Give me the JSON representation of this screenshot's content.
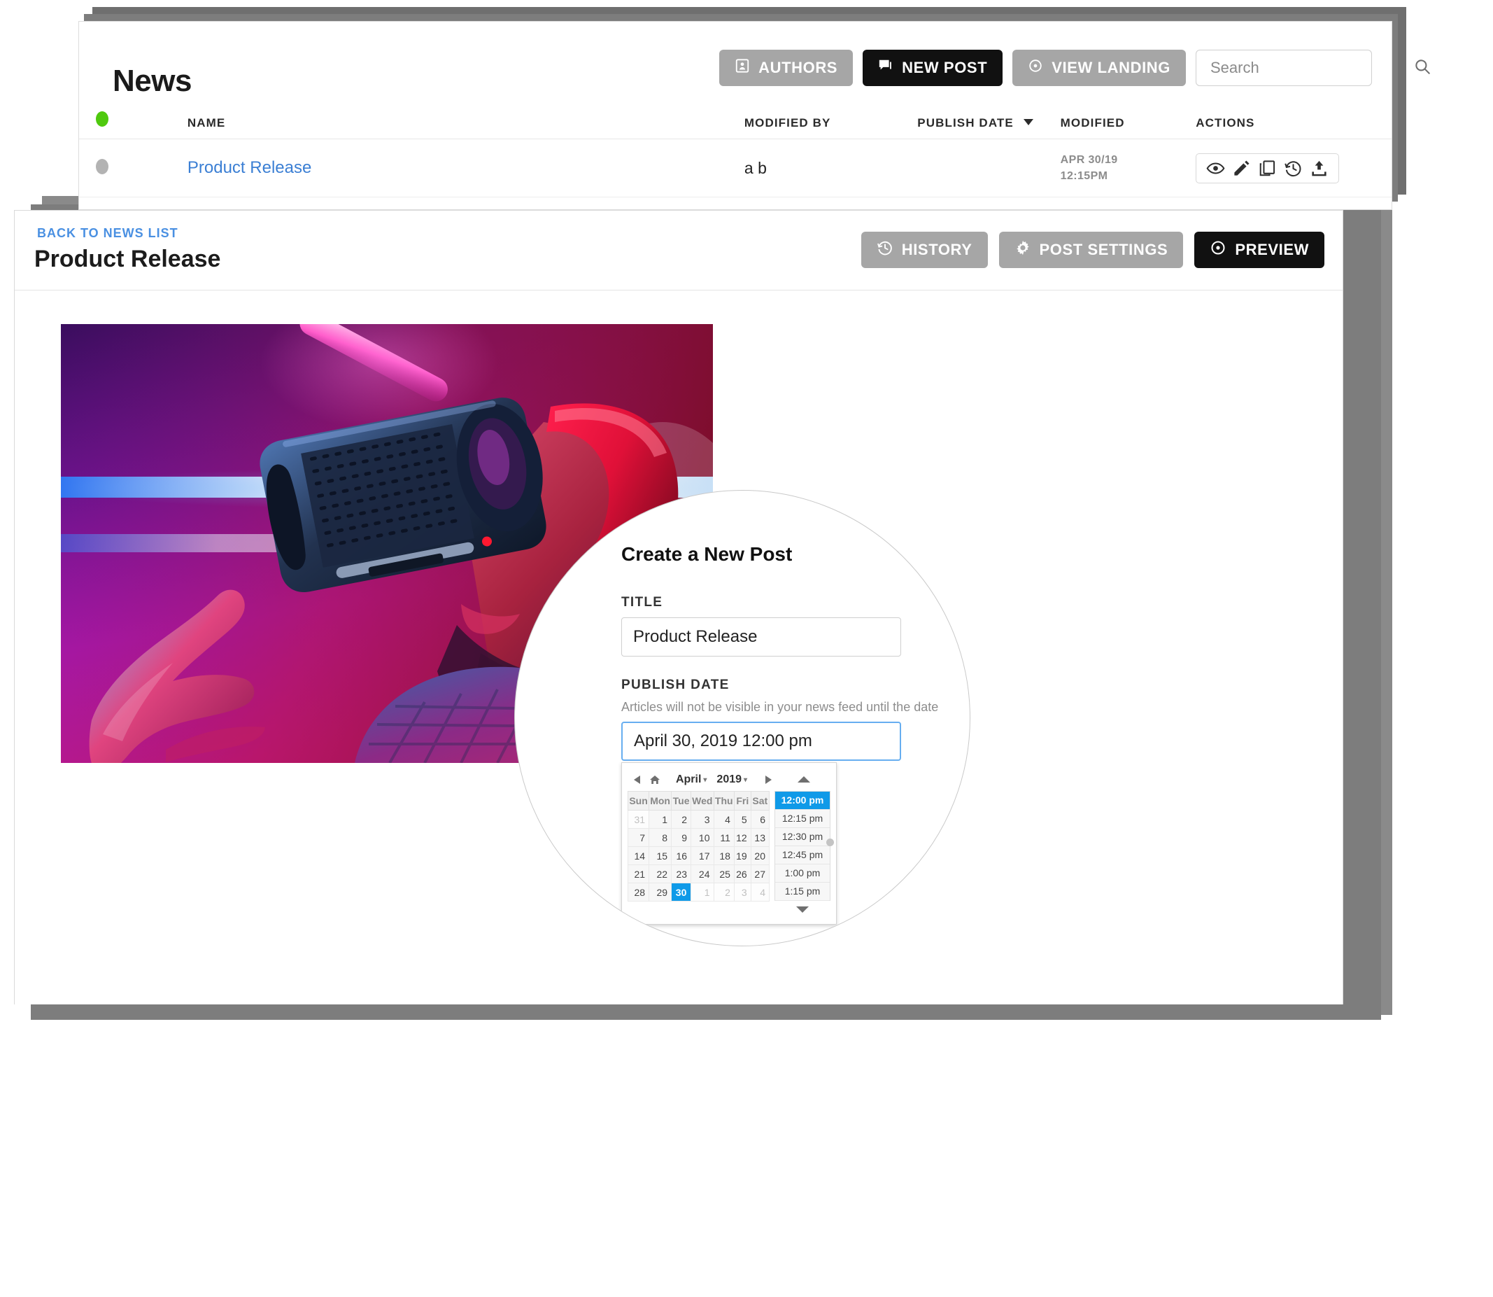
{
  "news_window": {
    "page_title": "News",
    "toolbar": {
      "authors_label": "AUTHORS",
      "new_post_label": "NEW POST",
      "view_landing_label": "VIEW LANDING",
      "search_placeholder": "Search",
      "search_value": ""
    },
    "table": {
      "columns": [
        "",
        "NAME",
        "MODIFIED BY",
        "PUBLISH DATE",
        "MODIFIED",
        "ACTIONS"
      ],
      "sort_column": "PUBLISH DATE",
      "sort_direction": "desc",
      "rows": [
        {
          "status": "draft",
          "name": "Product Release",
          "modified_by": "a b",
          "publish_date": "",
          "modified_date": "APR 30/19",
          "modified_time": "12:15PM",
          "actions": [
            "preview-icon",
            "edit-icon",
            "duplicate-icon",
            "history-icon",
            "publish-icon"
          ]
        }
      ]
    }
  },
  "post_window": {
    "back_link": "BACK TO NEWS LIST",
    "title": "Product Release",
    "actions": {
      "history_label": "HISTORY",
      "post_settings_label": "POST SETTINGS",
      "preview_label": "PREVIEW"
    },
    "hero_image_alt": "man wearing vr headset in neon lighting"
  },
  "magnifier": {
    "heading": "Create a New Post",
    "title_label": "TITLE",
    "title_value": "Product Release",
    "publish_date_label": "PUBLISH DATE",
    "publish_date_help": "Articles will not be visible in your news feed until the date",
    "publish_date_value": "April 30, 2019 12:00 pm",
    "datepicker": {
      "month": "April",
      "year": "2019",
      "weekdays": [
        "Sun",
        "Mon",
        "Tue",
        "Wed",
        "Thu",
        "Fri",
        "Sat"
      ],
      "weeks": [
        [
          {
            "d": "31",
            "o": true
          },
          {
            "d": "1"
          },
          {
            "d": "2"
          },
          {
            "d": "3"
          },
          {
            "d": "4"
          },
          {
            "d": "5"
          },
          {
            "d": "6"
          }
        ],
        [
          {
            "d": "7"
          },
          {
            "d": "8"
          },
          {
            "d": "9"
          },
          {
            "d": "10"
          },
          {
            "d": "11"
          },
          {
            "d": "12"
          },
          {
            "d": "13"
          }
        ],
        [
          {
            "d": "14"
          },
          {
            "d": "15"
          },
          {
            "d": "16"
          },
          {
            "d": "17"
          },
          {
            "d": "18"
          },
          {
            "d": "19"
          },
          {
            "d": "20"
          }
        ],
        [
          {
            "d": "21"
          },
          {
            "d": "22"
          },
          {
            "d": "23"
          },
          {
            "d": "24"
          },
          {
            "d": "25"
          },
          {
            "d": "26"
          },
          {
            "d": "27"
          }
        ],
        [
          {
            "d": "28"
          },
          {
            "d": "29"
          },
          {
            "d": "30",
            "sel": true
          },
          {
            "d": "1",
            "o": true
          },
          {
            "d": "2",
            "o": true
          },
          {
            "d": "3",
            "o": true
          },
          {
            "d": "4",
            "o": true
          }
        ]
      ],
      "selected_day": "30",
      "times": [
        {
          "t": "12:00 pm",
          "sel": true
        },
        {
          "t": "12:15 pm"
        },
        {
          "t": "12:30 pm"
        },
        {
          "t": "12:45 pm"
        },
        {
          "t": "1:00 pm"
        },
        {
          "t": "1:15 pm"
        }
      ],
      "selected_time": "12:00 pm"
    }
  },
  "colors": {
    "accent_blue": "#0f9ae8",
    "link_blue": "#3b7fd4",
    "status_green": "#4fc90e",
    "status_grey": "#b3b3b3",
    "button_grey": "#a6a6a6",
    "button_dark": "#111111"
  }
}
